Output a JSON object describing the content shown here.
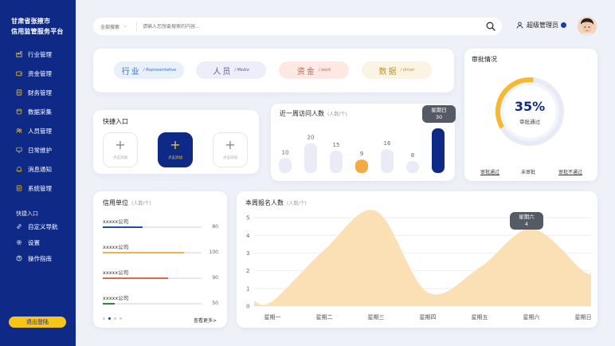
{
  "sidebar": {
    "brand_line1": "甘肃省张掖市",
    "brand_line2": "信用监管服务平台",
    "items": [
      {
        "label": "行业管理",
        "icon": "industry-icon"
      },
      {
        "label": "资金管理",
        "icon": "wallet-icon"
      },
      {
        "label": "财务管理",
        "icon": "finance-icon"
      },
      {
        "label": "数据采集",
        "icon": "data-icon"
      },
      {
        "label": "人员管理",
        "icon": "people-icon"
      },
      {
        "label": "日常维护",
        "icon": "monitor-icon"
      },
      {
        "label": "消息通知",
        "icon": "bell-icon"
      },
      {
        "label": "系统管理",
        "icon": "system-icon"
      }
    ],
    "quick_title": "快捷入口",
    "quick_items": [
      {
        "label": "自定义导航",
        "icon": "link-icon"
      },
      {
        "label": "设置",
        "icon": "gear-icon"
      },
      {
        "label": "操作指南",
        "icon": "help-icon"
      }
    ],
    "logout_label": "退出登陆"
  },
  "header": {
    "search_scope": "全部搜索",
    "search_placeholder": "请输入您想要搜索的内容...",
    "user_name": "超级管理员"
  },
  "categories": [
    {
      "main": "行业",
      "sub": "/ Representative",
      "bg": "#e8f1fb",
      "fg": "#3d6db5"
    },
    {
      "main": "人员",
      "sub": "/ Media",
      "bg": "#eeeefa",
      "fg": "#5c5c9a"
    },
    {
      "main": "资金",
      "sub": "/ work",
      "bg": "#fde8e4",
      "fg": "#d4614a"
    },
    {
      "main": "数据",
      "sub": "/ driver",
      "bg": "#fbf4e3",
      "fg": "#b89437"
    }
  ],
  "quick_entry": {
    "title": "快捷入口",
    "buttons": [
      {
        "label": "点击添加",
        "active": false
      },
      {
        "label": "点击添加",
        "active": true
      },
      {
        "label": "点击添加",
        "active": false
      }
    ]
  },
  "visits": {
    "title": "近一周访问人数",
    "unit": "(人数/个)",
    "tooltip_day": "星期日",
    "tooltip_value": "30"
  },
  "approval": {
    "title": "审批情况",
    "percent_text": "35%",
    "percent": 0.35,
    "center_label": "审批通过",
    "legend": [
      "审批通过",
      "未审批",
      "审批不通过"
    ]
  },
  "credit_units": {
    "title": "信用单位",
    "unit": "(人数/个)",
    "rows": [
      {
        "name": "xxxxx公司",
        "value": "80",
        "ratio": 0.4,
        "color": "#1f4fa5"
      },
      {
        "name": "xxxxx公司",
        "value": "100",
        "ratio": 0.82,
        "color": "#f0b14f"
      },
      {
        "name": "xxxxx公司",
        "value": "90",
        "ratio": 0.66,
        "color": "#e06a3f"
      },
      {
        "name": "xxxxx公司",
        "value": "50",
        "ratio": 0.12,
        "color": "#2e8a3a"
      }
    ],
    "more_label": "查看更多>"
  },
  "signups": {
    "title": "本周报名人数",
    "unit": "(人数/个)",
    "tooltip_day": "星期六",
    "tooltip_value": "4"
  },
  "chart_data": [
    {
      "type": "bar",
      "title": "近一周访问人数",
      "ylabel": "(人数/个)",
      "values": [
        10,
        20,
        15,
        9,
        16,
        8,
        30
      ],
      "highlight": {
        "index": 3,
        "color": "#f5a945"
      },
      "active": {
        "index": 6,
        "color": "#0f2a86",
        "label": "星期日"
      },
      "bar_color": "#e9ebf7"
    },
    {
      "type": "area",
      "title": "本周报名人数",
      "ylabel": "(人数/个)",
      "categories": [
        "星期一",
        "星期二",
        "星期三",
        "星期四",
        "星期五",
        "星期六",
        "星期日"
      ],
      "values": [
        0.3,
        3.2,
        5.4,
        0.8,
        2.2,
        4.4,
        2.0
      ],
      "yticks": [
        0,
        1,
        2,
        3,
        4,
        5
      ],
      "ylim": [
        0,
        5.5
      ],
      "grid": true,
      "fill": "#fbe0b5",
      "stroke": "#f6c785"
    }
  ]
}
